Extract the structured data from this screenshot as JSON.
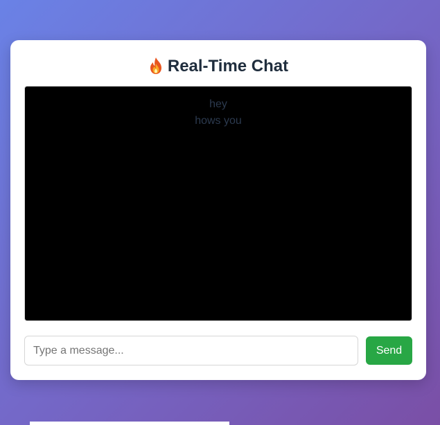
{
  "app": {
    "title": "Real-Time Chat",
    "title_icon": "fire-icon"
  },
  "messages": [
    {
      "text": "hey"
    },
    {
      "text": "hows you"
    }
  ],
  "composer": {
    "placeholder": "Type a message...",
    "value": "",
    "send_label": "Send"
  },
  "colors": {
    "background_gradient": [
      "#6a82e6",
      "#7a4fa6"
    ],
    "card": "#ffffff",
    "message_area": "#000000",
    "message_text": "#2c3a4f",
    "send_button": "#28a745",
    "title_text": "#1f2d3d"
  }
}
